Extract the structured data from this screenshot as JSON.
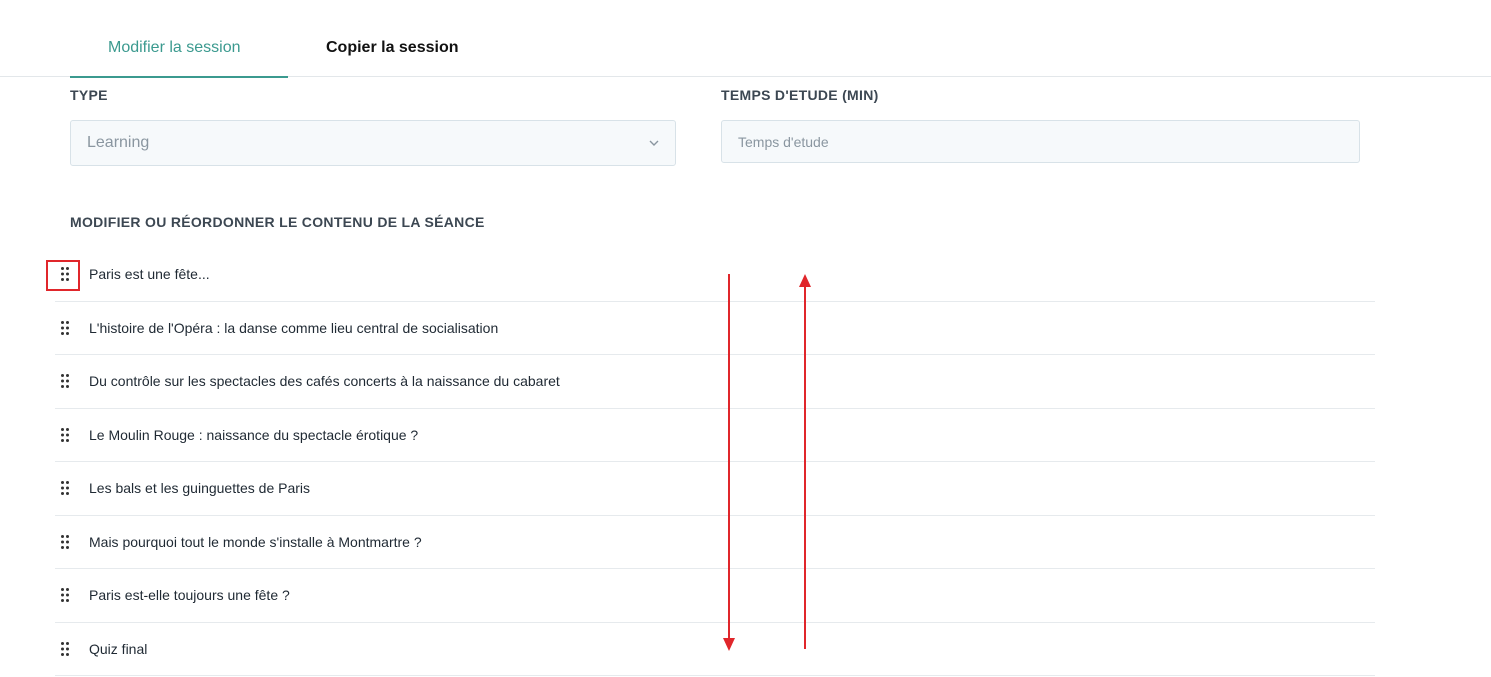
{
  "tabs": [
    {
      "label": "Modifier la session",
      "active": true
    },
    {
      "label": "Copier la session",
      "active": false
    }
  ],
  "fields": {
    "type_label": "TYPE",
    "type_value": "Learning",
    "time_label": "TEMPS D'ETUDE (MIN)",
    "time_placeholder": "Temps d'etude"
  },
  "section": {
    "title": "MODIFIER OU RÉORDONNER LE CONTENU DE LA SÉANCE"
  },
  "items": [
    {
      "label": "Paris est une fête..."
    },
    {
      "label": "L'histoire de l'Opéra : la danse comme lieu central de socialisation"
    },
    {
      "label": "Du contrôle sur les spectacles des cafés concerts à la naissance du cabaret"
    },
    {
      "label": "Le Moulin Rouge : naissance du spectacle érotique ?"
    },
    {
      "label": "Les bals et les guinguettes de Paris"
    },
    {
      "label": "Mais pourquoi tout le monde s'installe à Montmartre ?"
    },
    {
      "label": "Paris est-elle toujours une fête ?"
    },
    {
      "label": "Quiz final"
    }
  ],
  "colors": {
    "accent": "#3b9a8f",
    "annotation": "#e0262b"
  },
  "icons": {
    "drag_handle": "drag-handle-icon",
    "select_chevron": "chevron-down-icon"
  }
}
